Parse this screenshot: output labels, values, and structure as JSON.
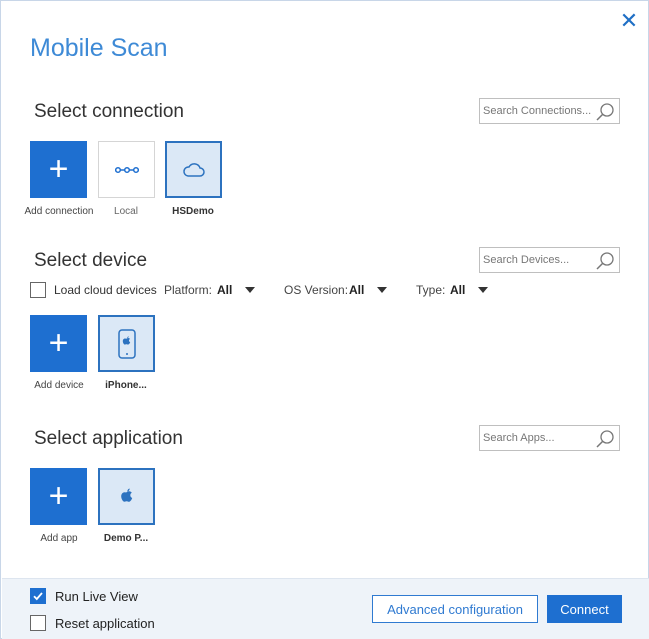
{
  "window": {
    "title": "Mobile Scan"
  },
  "connection": {
    "heading": "Select connection",
    "search_placeholder": "Search Connections...",
    "tiles": [
      {
        "label": "Add connection",
        "icon": "plus-icon"
      },
      {
        "label": "Local",
        "icon": "local-network-icon"
      },
      {
        "label": "HSDemo",
        "icon": "cloud-icon",
        "selected": true
      }
    ]
  },
  "device": {
    "heading": "Select device",
    "search_placeholder": "Search Devices...",
    "load_cloud_label": "Load cloud devices",
    "load_cloud_checked": false,
    "filters": {
      "platform_label": "Platform:",
      "platform_value": "All",
      "os_label": "OS Version:",
      "os_value": "All",
      "type_label": "Type:",
      "type_value": "All"
    },
    "tiles": [
      {
        "label": "Add device",
        "icon": "plus-icon"
      },
      {
        "label": "iPhone...",
        "icon": "iphone-icon",
        "selected": true
      }
    ]
  },
  "application": {
    "heading": "Select application",
    "search_placeholder": "Search Apps...",
    "tiles": [
      {
        "label": "Add app",
        "icon": "plus-icon"
      },
      {
        "label": "Demo P...",
        "icon": "apple-icon",
        "selected": true
      }
    ]
  },
  "footer": {
    "run_live_view_label": "Run Live View",
    "run_live_view_checked": true,
    "reset_application_label": "Reset application",
    "reset_application_checked": false,
    "advanced_button": "Advanced configuration",
    "connect_button": "Connect"
  },
  "colors": {
    "accent": "#1e6fd0",
    "title": "#3e8ad6",
    "selected_tile_bg": "#dbe8f6",
    "footer_bg": "#eef3f9"
  }
}
